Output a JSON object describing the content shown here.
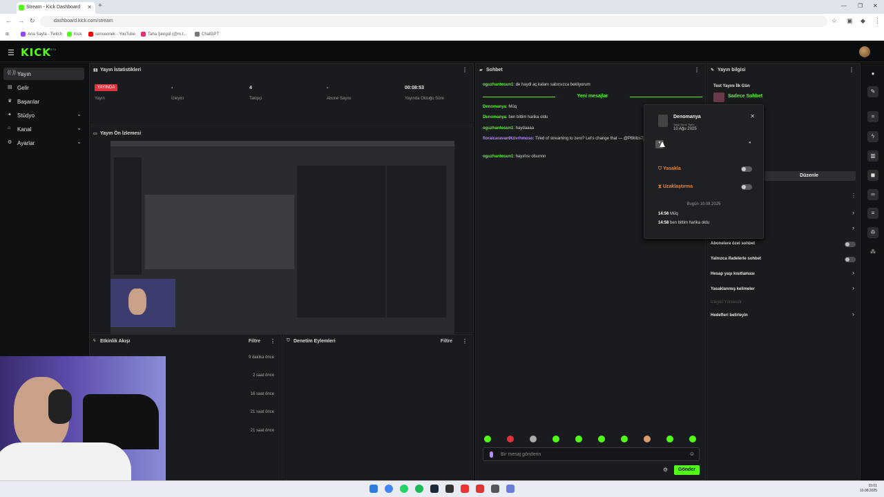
{
  "browser": {
    "tab_title": "Stream - Kick Dashboard",
    "url": "dashboard.kick.com/stream",
    "bookmarks": [
      {
        "label": "Ana Sayfa - Twitch",
        "color": "#9146ff"
      },
      {
        "label": "Kick",
        "color": "#53fc18"
      },
      {
        "label": "senseonek - YouTube",
        "color": "#ff0000"
      },
      {
        "label": "Taha Şengül (@m.t...",
        "color": "#e1306c"
      },
      {
        "label": "ChatGPT",
        "color": "#777777"
      }
    ]
  },
  "app": {
    "logo": "KICK",
    "beta": "BETA"
  },
  "sidebar": {
    "items": [
      {
        "label": "Yayın",
        "icon": "broadcast-icon",
        "active": true
      },
      {
        "label": "Gelir",
        "icon": "wallet-icon"
      },
      {
        "label": "Başarılar",
        "icon": "trophy-icon"
      },
      {
        "label": "Stüdyo",
        "icon": "studio-icon",
        "chevron": true
      },
      {
        "label": "Kanal",
        "icon": "channel-icon",
        "chevron": true
      },
      {
        "label": "Ayarlar",
        "icon": "gear-icon",
        "chevron": true
      }
    ]
  },
  "stats": {
    "title": "Yayın İstatistikleri",
    "live_badge": "YAYINDA",
    "items": [
      {
        "value": "",
        "label": "Yayın"
      },
      {
        "value": "-",
        "label": "İzleyici"
      },
      {
        "value": "4",
        "label": "Takipçi"
      },
      {
        "value": "-",
        "label": "Abone Sayısı"
      },
      {
        "value": "00:08:53",
        "label": "Yayında Olduğu Süre"
      }
    ]
  },
  "preview": {
    "title": "Yayın Ön İzlemesi"
  },
  "activity": {
    "title": "Etkinlik Akışı",
    "filter": "Filtre",
    "times": [
      "9 dakika önce",
      "2 saat önce",
      "16 saat önce",
      "21 saat önce",
      "21 saat önce"
    ]
  },
  "moderation": {
    "title": "Denetim Eylemleri",
    "filter": "Filtre"
  },
  "chat": {
    "title": "Sohbet",
    "new_messages": "Yeni mesajlar",
    "messages": [
      {
        "user": "oguzhantosun1",
        "text": "de haydi aç kalanı sabırsızca bekliyorum"
      },
      {
        "user": "Denomanya",
        "text": "Müq"
      },
      {
        "user": "Denomanya",
        "text": "ben bittim harika oldu"
      },
      {
        "user": "oguzhantosun1",
        "text": "haydaaaa"
      },
      {
        "user": "floralcaravan9tzivrhmoso",
        "text": "Tired of streaming to zero? Let's change that — @PBMzs7jj"
      },
      {
        "user": "oguzhantosun1",
        "text": "hayırlısı olsunnn"
      }
    ],
    "placeholder": "Bir mesaj gönderin",
    "send": "Gönder"
  },
  "user_card": {
    "username": "Denomanya",
    "follow_label": "Takip Etme Tarihi",
    "follow_date": "10 Ağu 2025",
    "ban": "Yasakla",
    "timeout": "Uzaklaştırma",
    "day_label": "Bugün 10.08.2025",
    "history": [
      {
        "time": "14:56",
        "text": "Müq"
      },
      {
        "time": "14:58",
        "text": "ben bittim harika oldu"
      }
    ]
  },
  "stream_info": {
    "title": "Yayın bilgisi",
    "stream_title": "Test Yayını İlk Gün",
    "category": "Sadece Sohbet",
    "edit": "Düzenle",
    "settings": [
      {
        "label": "Abonelere özel sohbet",
        "type": "toggle"
      },
      {
        "label": "Yalnızca ifadelerle sohbet",
        "type": "toggle"
      },
      {
        "label": "Hesap yaşı kısıtlaması",
        "type": "chevron"
      },
      {
        "label": "Yasaklanmış kelimeler",
        "type": "chevron"
      },
      {
        "label": "İzleyici Yönlendir",
        "type": "disabled"
      },
      {
        "label": "Hedefleri belirleyin",
        "type": "chevron"
      }
    ]
  },
  "taskbar": {
    "time": "15:01",
    "date": "10.08.2025"
  }
}
